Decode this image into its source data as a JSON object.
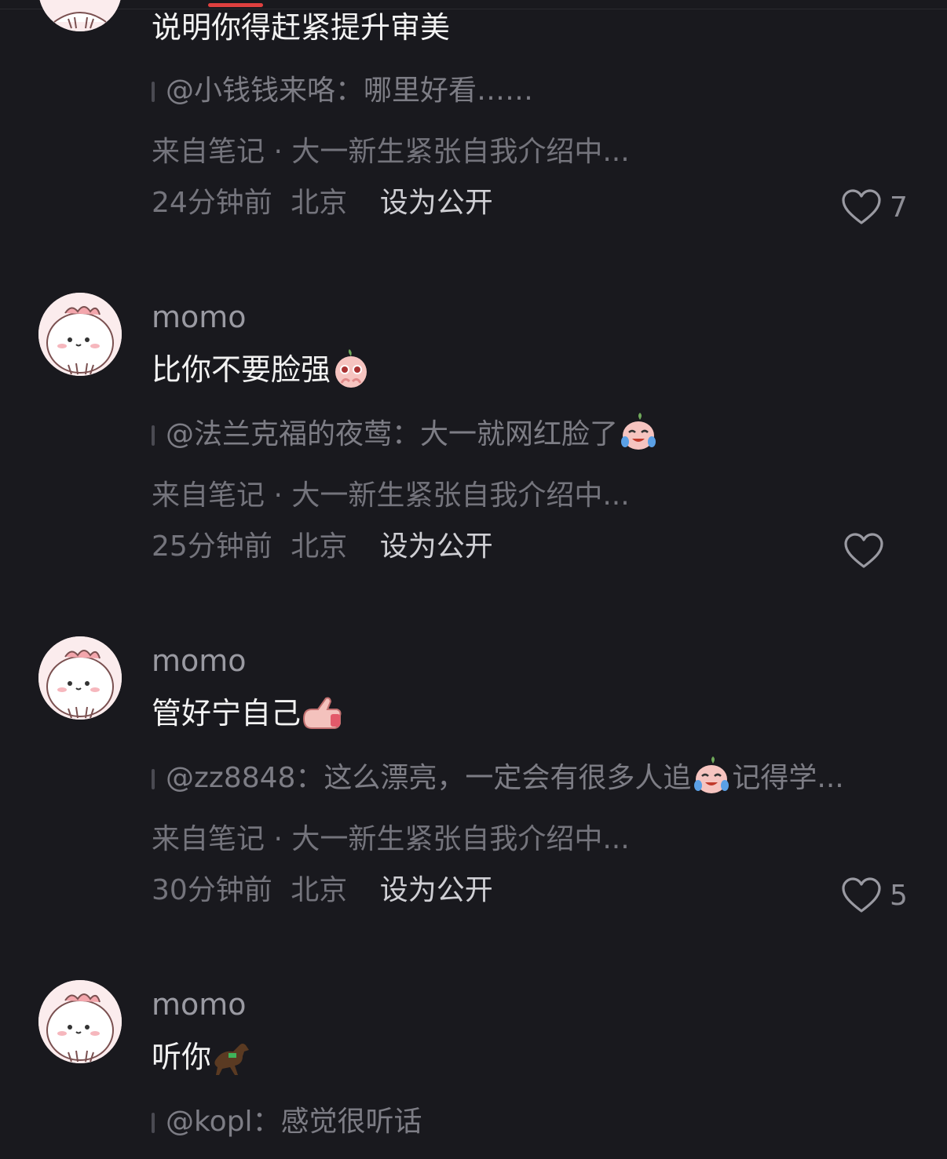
{
  "comments": [
    {
      "username": "",
      "text": "说明你得赶紧提升审美",
      "emoji": "",
      "quote": "@小钱钱来咯：哪里好看……",
      "source": "来自笔记 · 大一新生紧张自我介绍中...",
      "time": "24分钟前",
      "location": "北京",
      "public_label": "设为公开",
      "likes": "7"
    },
    {
      "username": "momo",
      "text": "比你不要脸强",
      "emoji": "pleading-face-icon",
      "quote": "@法兰克福的夜莺：大一就网红脸了",
      "quote_emoji": "crying-laughing-icon",
      "source": "来自笔记 · 大一新生紧张自我介绍中...",
      "time": "25分钟前",
      "location": "北京",
      "public_label": "设为公开",
      "likes": ""
    },
    {
      "username": "momo",
      "text": "管好宁自己",
      "emoji": "pointing-hand-icon",
      "quote": "@zz8848：这么漂亮，一定会有很多人追",
      "quote_emoji": "crying-laughing-icon",
      "quote_tail": "记得学...",
      "source": "来自笔记 · 大一新生紧张自我介绍中...",
      "time": "30分钟前",
      "location": "北京",
      "public_label": "设为公开",
      "likes": "5"
    },
    {
      "username": "momo",
      "text": "听你",
      "emoji": "horse-icon",
      "quote": "@kopl：感觉很听话"
    }
  ],
  "colors": {
    "background": "#19191e",
    "accent": "#e0403f",
    "avatar_bg": "#fbeced"
  }
}
